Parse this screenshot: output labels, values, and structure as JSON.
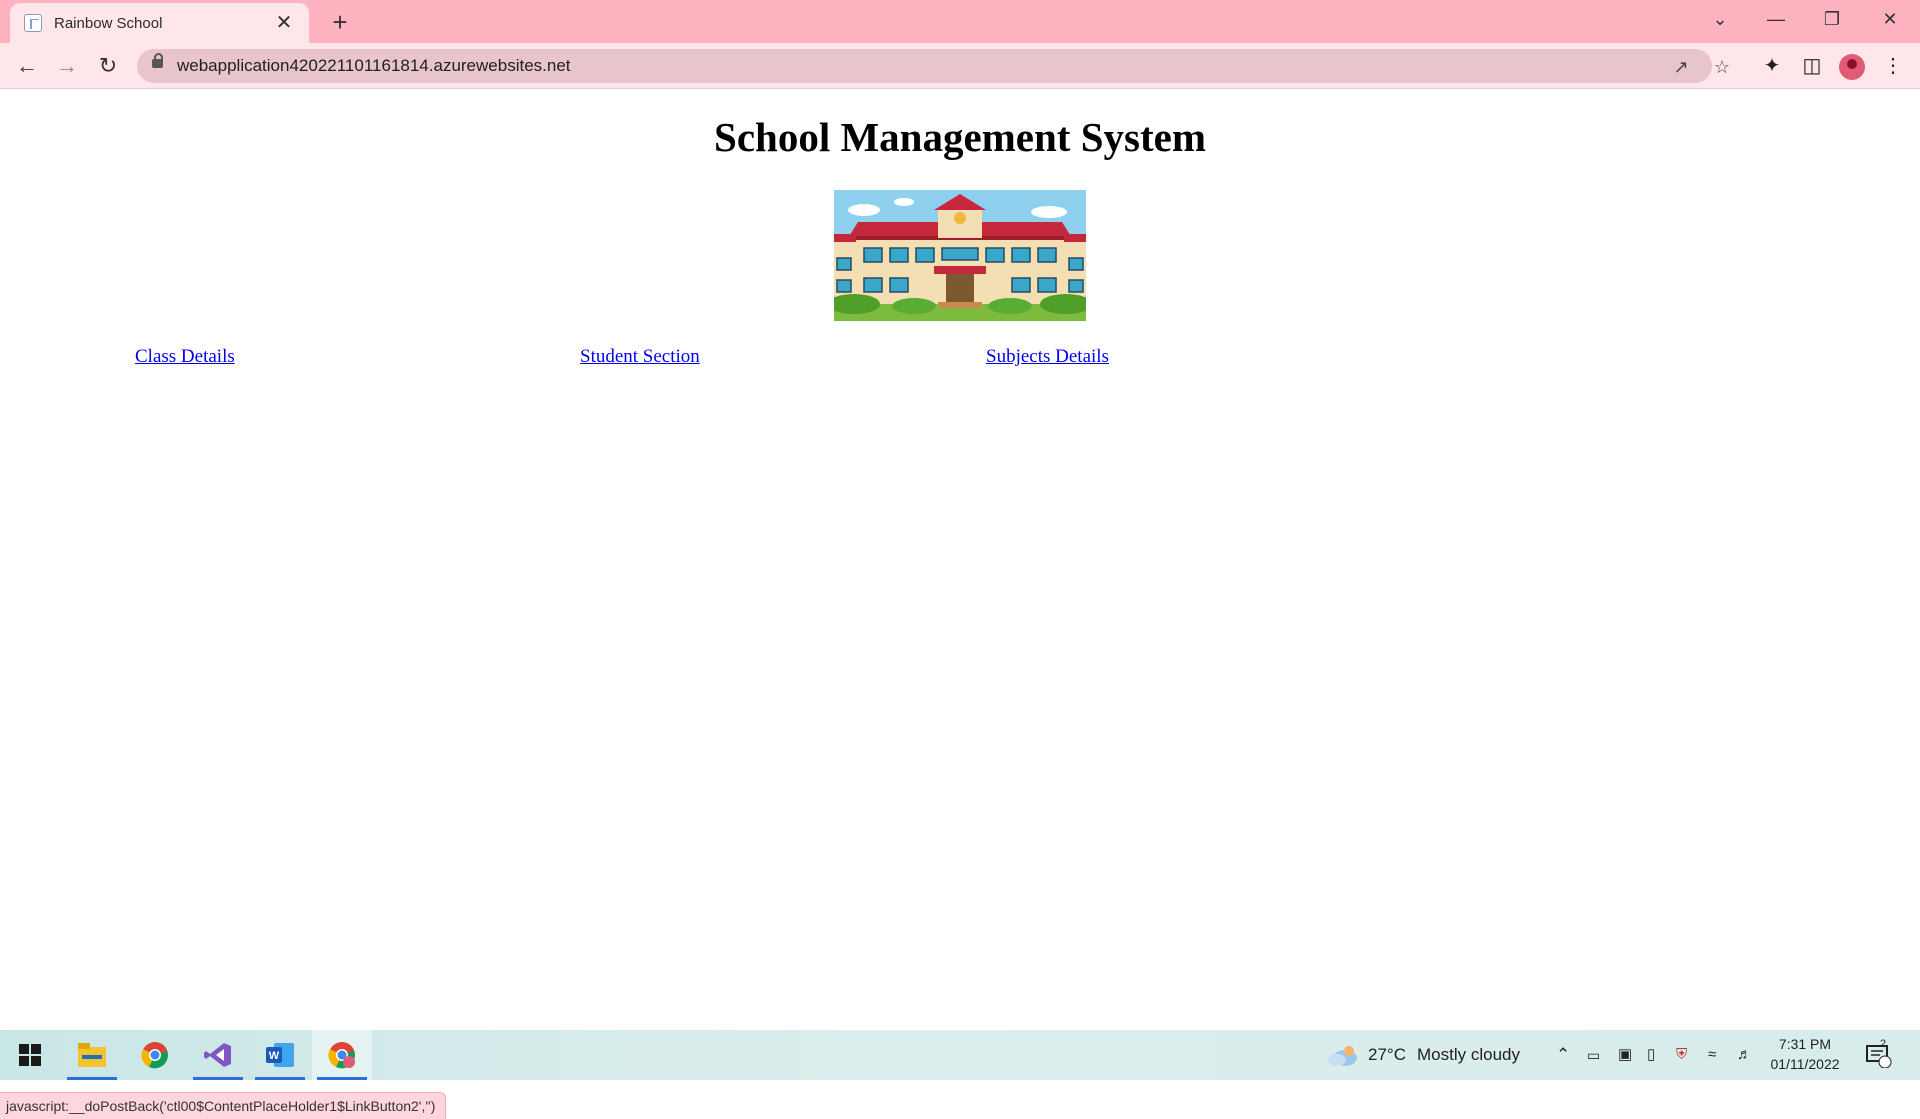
{
  "browser": {
    "tab_title": "Rainbow School",
    "tab_close": "✕",
    "new_tab": "+",
    "url": "webapplication420221101161814.azurewebsites.net",
    "controls": {
      "tab_search": "⌄",
      "minimize": "—",
      "restore": "❐",
      "close": "✕"
    }
  },
  "page": {
    "title": "School Management System",
    "links": [
      "Class Details",
      "Student Section",
      "Subjects Details"
    ]
  },
  "status_bar": {
    "text": "javascript:__doPostBack('ctl00$ContentPlaceHolder1$LinkButton2','')"
  },
  "taskbar": {
    "weather_temp": "27°C",
    "weather_desc": "Mostly cloudy",
    "time": "7:31 PM",
    "date": "01/11/2022",
    "notification_count": "2"
  },
  "colors": {
    "browser_frame": "#ffb3c0",
    "toolbar": "#ffe6eb",
    "link": "#0000ee",
    "taskbar_indicator": "#2a6fdb"
  }
}
